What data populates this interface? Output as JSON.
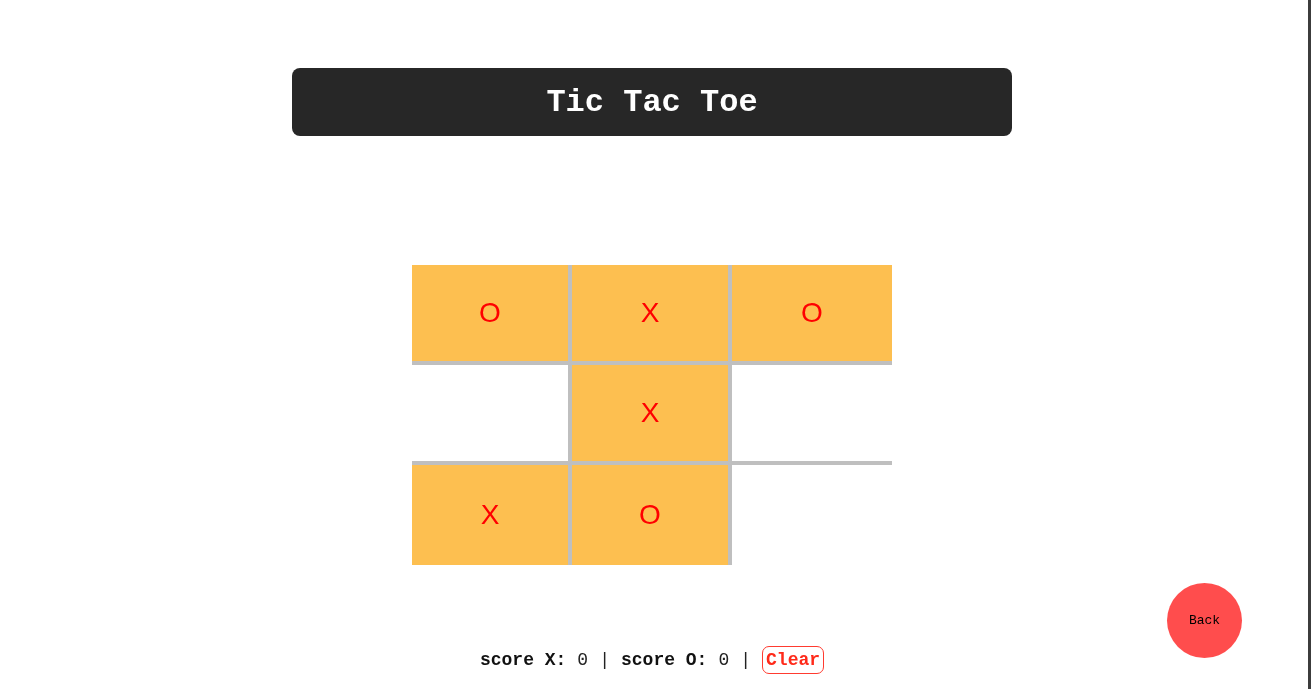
{
  "title": "Tic Tac Toe",
  "board": {
    "rows": [
      [
        "O",
        "X",
        "O"
      ],
      [
        null,
        "X",
        null
      ],
      [
        "X",
        "O",
        null
      ]
    ]
  },
  "scores": [
    {
      "label": "score X:",
      "value": "0",
      "separator": "|"
    },
    {
      "label": "score O:",
      "value": "0",
      "separator": "|"
    }
  ],
  "clear_button": "Clear",
  "back_button": "Back"
}
